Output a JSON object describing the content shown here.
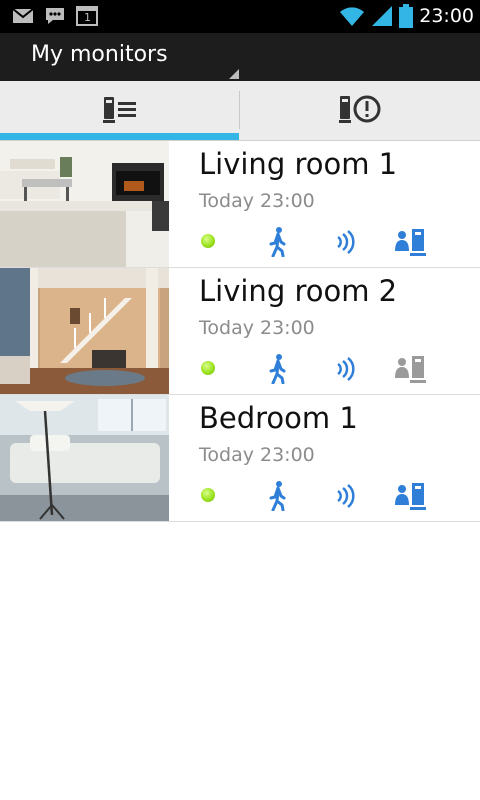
{
  "status_bar": {
    "time": "23:00",
    "calendar_day": "1",
    "icons": [
      "gmail-icon",
      "chat-icon",
      "calendar-icon",
      "wifi-icon",
      "signal-icon",
      "battery-icon"
    ]
  },
  "action_bar": {
    "title": "My monitors"
  },
  "tabs": [
    {
      "name": "monitor-list-tab",
      "icon": "monitor-list-icon",
      "selected": true
    },
    {
      "name": "alerts-tab",
      "icon": "monitor-alert-icon",
      "selected": false
    }
  ],
  "colors": {
    "accent": "#33b5e5",
    "icon_blue": "#2f7fd8",
    "icon_gray": "#9a9a9a",
    "status_green": "#9be21f"
  },
  "monitors": [
    {
      "name": "Living room 1",
      "time": "Today 23:00",
      "online": true,
      "motion": true,
      "sound": true,
      "presence_active": true,
      "thumbnail": "living-room-1-photo"
    },
    {
      "name": "Living room 2",
      "time": "Today 23:00",
      "online": true,
      "motion": true,
      "sound": true,
      "presence_active": false,
      "thumbnail": "living-room-2-photo"
    },
    {
      "name": "Bedroom 1",
      "time": "Today 23:00",
      "online": true,
      "motion": true,
      "sound": true,
      "presence_active": true,
      "thumbnail": "bedroom-1-photo"
    }
  ]
}
